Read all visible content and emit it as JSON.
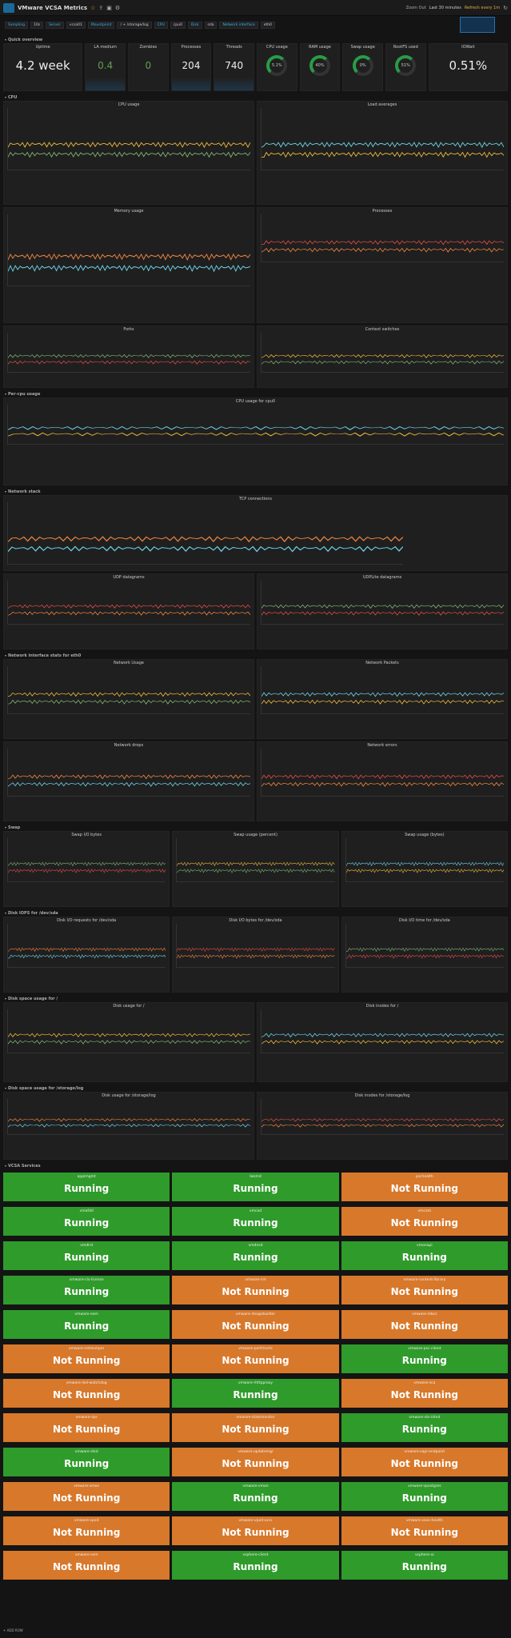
{
  "nav": {
    "title": "VMware VCSA Metrics",
    "zoom": "Zoom Out",
    "time": "Last 30 minutes",
    "refresh": "Refresh every 1m"
  },
  "vars": [
    {
      "l": "Sampling",
      "v": "10s"
    },
    {
      "l": "Server",
      "v": "vcsa01"
    },
    {
      "l": "Mountpoint",
      "v": "/ + /storage/log"
    },
    {
      "l": "CPU",
      "v": "cpu0"
    },
    {
      "l": "Disk",
      "v": "sda"
    },
    {
      "l": "Network interface",
      "v": "eth0"
    }
  ],
  "rows": {
    "quick": "Quick overview",
    "cpu": "CPU",
    "percpu": "Per-cpu usage",
    "net": "Network stack",
    "netif": "Network interface stats for eth0",
    "swap": "Swap",
    "diskio": "Disk IOPS for /dev/sda",
    "diskspace": "Disk space usage for /",
    "diskspacelog": "Disk space usage for /storage/log",
    "services": "VCSA Services"
  },
  "quick": {
    "uptime_label": "Uptime",
    "uptime": "4.2 week",
    "la_label": "LA medium",
    "la": "0.4",
    "zombies_label": "Zombies",
    "zombies": "0",
    "proc_label": "Processes",
    "proc": "204",
    "threads_label": "Threads",
    "threads": "740",
    "cpuu_label": "CPU usage",
    "cpuu": "5.1%",
    "ram_label": "RAM usage",
    "ram": "40%",
    "swap_label": "Swap usage",
    "swap": "0%",
    "rootfs_label": "RootFS used",
    "rootfs": "51%",
    "iowait_label": "IOWait",
    "iowait": "0.51%"
  },
  "panels": {
    "cpu_usage": "CPU usage",
    "load": "Load averages",
    "memory": "Memory usage",
    "processes": "Processes",
    "forks": "Forks",
    "ctx": "Context switches",
    "percpu": "CPU usage for cpu0",
    "tcp": "TCP connections",
    "udp": "UDP datagrams",
    "udplite": "UDPLite datagrams",
    "netusage": "Network Usage",
    "netpkts": "Network Packets",
    "netdrops": "Network drops",
    "neterr": "Network errors",
    "swapio": "Swap I/O bytes",
    "swappct": "Swap usage (percent)",
    "swapbytes": "Swap usage (bytes)",
    "diskreq": "Disk I/O requests for /dev/sda",
    "diskbytes": "Disk I/O bytes for /dev/sda",
    "disktime": "Disk I/O time for /dev/sda",
    "diskroot": "Disk usage for /",
    "inoderoot": "Disk inodes for /",
    "disklog": "Disk usage for /storage/log",
    "inodelog": "Disk inodes for /storage/log"
  },
  "services": [
    {
      "n": "applmgmt",
      "s": "Running"
    },
    {
      "n": "lwsmd",
      "s": "Running"
    },
    {
      "n": "pschealth",
      "s": "Not Running"
    },
    {
      "n": "vmafdd",
      "s": "Running"
    },
    {
      "n": "vmcad",
      "s": "Running"
    },
    {
      "n": "vmcam",
      "s": "Not Running"
    },
    {
      "n": "vmdird",
      "s": "Running"
    },
    {
      "n": "vmdnsd",
      "s": "Running"
    },
    {
      "n": "vmonapi",
      "s": "Running"
    },
    {
      "n": "vmware-cis-license",
      "s": "Running"
    },
    {
      "n": "vmware-cm",
      "s": "Not Running"
    },
    {
      "n": "vmware-content-library",
      "s": "Not Running"
    },
    {
      "n": "vmware-eam",
      "s": "Running"
    },
    {
      "n": "vmware-imagebuilder",
      "s": "Not Running"
    },
    {
      "n": "vmware-mbcs",
      "s": "Not Running"
    },
    {
      "n": "vmware-netdumper",
      "s": "Not Running"
    },
    {
      "n": "vmware-perfcharts",
      "s": "Not Running"
    },
    {
      "n": "vmware-psc-client",
      "s": "Running"
    },
    {
      "n": "vmware-rbd-watchdog",
      "s": "Not Running"
    },
    {
      "n": "vmware-rhttpproxy",
      "s": "Running"
    },
    {
      "n": "vmware-sca",
      "s": "Not Running"
    },
    {
      "n": "vmware-sps",
      "s": "Not Running"
    },
    {
      "n": "vmware-statsmonitor",
      "s": "Not Running"
    },
    {
      "n": "vmware-sts-idmd",
      "s": "Running"
    },
    {
      "n": "vmware-stsd",
      "s": "Running"
    },
    {
      "n": "vmware-updatemgr",
      "s": "Not Running"
    },
    {
      "n": "vmware-vapi-endpoint",
      "s": "Not Running"
    },
    {
      "n": "vmware-vmon",
      "s": "Not Running"
    },
    {
      "n": "vmware-vmon",
      "s": "Running"
    },
    {
      "n": "vmware-vpostgres",
      "s": "Running"
    },
    {
      "n": "vmware-vpxd",
      "s": "Not Running"
    },
    {
      "n": "vmware-vpxd-svcs",
      "s": "Not Running"
    },
    {
      "n": "vmware-vsan-health",
      "s": "Not Running"
    },
    {
      "n": "vmware-vsm",
      "s": "Not Running"
    },
    {
      "n": "vsphere-client",
      "s": "Running"
    },
    {
      "n": "vsphere-ui",
      "s": "Running"
    }
  ],
  "add_row": "+ ADD ROW",
  "colors": {
    "running": "#2f9b2b",
    "notrunning": "#d8782b",
    "accent": "#33b5e5"
  }
}
